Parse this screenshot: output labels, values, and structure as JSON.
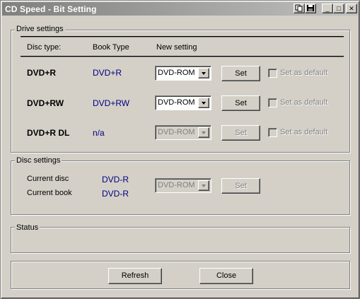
{
  "window": {
    "title": "CD Speed - Bit Setting",
    "buttons": {
      "minimize": "_",
      "maximize": "□",
      "close": "✕"
    }
  },
  "drive_settings": {
    "label": "Drive settings",
    "headers": {
      "disc_type": "Disc type:",
      "book_type": "Book Type",
      "new_setting": "New setting"
    },
    "rows": [
      {
        "disc": "DVD+R",
        "book": "DVD+R",
        "setting": "DVD-ROM",
        "enabled": true,
        "set": "Set",
        "default": "Set as default"
      },
      {
        "disc": "DVD+RW",
        "book": "DVD+RW",
        "setting": "DVD-ROM",
        "enabled": true,
        "set": "Set",
        "default": "Set as default"
      },
      {
        "disc": "DVD+R DL",
        "book": "n/a",
        "setting": "DVD-ROM",
        "enabled": false,
        "set": "Set",
        "default": "Set as default"
      }
    ]
  },
  "disc_settings": {
    "label": "Disc settings",
    "current_disc_label": "Current disc",
    "current_disc_value": "DVD-R",
    "current_book_label": "Current book",
    "current_book_value": "DVD-R",
    "setting": "DVD-ROM",
    "set": "Set"
  },
  "status": {
    "label": "Status"
  },
  "footer": {
    "refresh": "Refresh",
    "close": "Close"
  }
}
